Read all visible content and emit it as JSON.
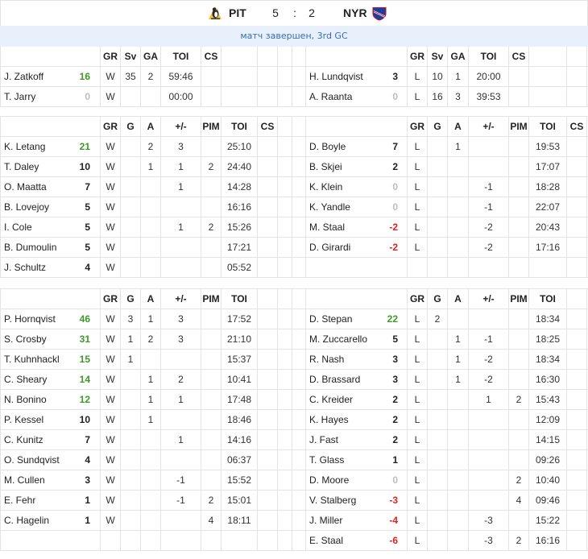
{
  "colors": {
    "points_high": "#3c9a28",
    "points_normal": "#222222",
    "points_zero": "#bdbdbd",
    "points_negative": "#e0221b",
    "status_text": "#3b6bb5",
    "status_bg": "#e8f1fb"
  },
  "header": {
    "home": {
      "abbr": "PIT",
      "score": "5",
      "logo_icon": "penguins-logo-icon"
    },
    "score_separator": ":",
    "away": {
      "abbr": "NYR",
      "score": "2",
      "logo_icon": "rangers-logo-icon"
    },
    "status": "матч завершен, 3rd GC"
  },
  "sections": [
    {
      "columns": [
        "GR",
        "Sv",
        "GA",
        "TOI",
        "CS"
      ],
      "home": [
        {
          "name": "J. Zatkoff",
          "points": 16,
          "stats": [
            "W",
            "35",
            "2",
            "59:46",
            ""
          ]
        },
        {
          "name": "T. Jarry",
          "points": 0,
          "stats": [
            "W",
            "",
            "",
            "00:00",
            ""
          ]
        }
      ],
      "away": [
        {
          "name": "H. Lundqvist",
          "points": 3,
          "stats": [
            "L",
            "10",
            "1",
            "20:00",
            ""
          ]
        },
        {
          "name": "A. Raanta",
          "points": 0,
          "stats": [
            "L",
            "16",
            "3",
            "39:53",
            ""
          ]
        }
      ]
    },
    {
      "columns": [
        "GR",
        "G",
        "A",
        "+/-",
        "PIM",
        "TOI",
        "CS"
      ],
      "home": [
        {
          "name": "K. Letang",
          "points": 21,
          "stats": [
            "W",
            "",
            "2",
            "3",
            "",
            "25:10",
            ""
          ]
        },
        {
          "name": "T. Daley",
          "points": 10,
          "stats": [
            "W",
            "",
            "1",
            "1",
            "2",
            "24:40",
            ""
          ]
        },
        {
          "name": "O. Maatta",
          "points": 7,
          "stats": [
            "W",
            "",
            "",
            "1",
            "",
            "14:28",
            ""
          ]
        },
        {
          "name": "B. Lovejoy",
          "points": 5,
          "stats": [
            "W",
            "",
            "",
            "",
            "",
            "16:16",
            ""
          ]
        },
        {
          "name": "I. Cole",
          "points": 5,
          "stats": [
            "W",
            "",
            "",
            "1",
            "2",
            "15:26",
            ""
          ]
        },
        {
          "name": "B. Dumoulin",
          "points": 5,
          "stats": [
            "W",
            "",
            "",
            "",
            "",
            "17:21",
            ""
          ]
        },
        {
          "name": "J. Schultz",
          "points": 4,
          "stats": [
            "W",
            "",
            "",
            "",
            "",
            "05:52",
            ""
          ]
        }
      ],
      "away": [
        {
          "name": "D. Boyle",
          "points": 7,
          "stats": [
            "L",
            "",
            "1",
            "",
            "",
            "19:53",
            ""
          ]
        },
        {
          "name": "B. Skjei",
          "points": 2,
          "stats": [
            "L",
            "",
            "",
            "",
            "",
            "17:07",
            ""
          ]
        },
        {
          "name": "K. Klein",
          "points": 0,
          "stats": [
            "L",
            "",
            "",
            "-1",
            "",
            "18:28",
            ""
          ]
        },
        {
          "name": "K. Yandle",
          "points": 0,
          "stats": [
            "L",
            "",
            "",
            "-1",
            "",
            "22:07",
            ""
          ]
        },
        {
          "name": "M. Staal",
          "points": -2,
          "stats": [
            "L",
            "",
            "",
            "-2",
            "",
            "20:43",
            ""
          ]
        },
        {
          "name": "D. Girardi",
          "points": -2,
          "stats": [
            "L",
            "",
            "",
            "-2",
            "",
            "17:16",
            ""
          ]
        }
      ]
    },
    {
      "columns": [
        "GR",
        "G",
        "A",
        "+/-",
        "PIM",
        "TOI"
      ],
      "home": [
        {
          "name": "P. Hornqvist",
          "points": 46,
          "stats": [
            "W",
            "3",
            "1",
            "3",
            "",
            "17:52"
          ]
        },
        {
          "name": "S. Crosby",
          "points": 31,
          "stats": [
            "W",
            "1",
            "2",
            "3",
            "",
            "21:10"
          ]
        },
        {
          "name": "T. Kuhnhackl",
          "points": 15,
          "stats": [
            "W",
            "1",
            "",
            "",
            "",
            "15:37"
          ]
        },
        {
          "name": "C. Sheary",
          "points": 14,
          "stats": [
            "W",
            "",
            "1",
            "2",
            "",
            "10:41"
          ]
        },
        {
          "name": "N. Bonino",
          "points": 12,
          "stats": [
            "W",
            "",
            "1",
            "1",
            "",
            "17:48"
          ]
        },
        {
          "name": "P. Kessel",
          "points": 10,
          "stats": [
            "W",
            "",
            "1",
            "",
            "",
            "18:46"
          ]
        },
        {
          "name": "C. Kunitz",
          "points": 7,
          "stats": [
            "W",
            "",
            "",
            "1",
            "",
            "14:16"
          ]
        },
        {
          "name": "O. Sundqvist",
          "points": 4,
          "stats": [
            "W",
            "",
            "",
            "",
            "",
            "06:37"
          ]
        },
        {
          "name": "M. Cullen",
          "points": 3,
          "stats": [
            "W",
            "",
            "",
            "-1",
            "",
            "15:52"
          ]
        },
        {
          "name": "E. Fehr",
          "points": 1,
          "stats": [
            "W",
            "",
            "",
            "-1",
            "2",
            "15:01"
          ]
        },
        {
          "name": "C. Hagelin",
          "points": 1,
          "stats": [
            "W",
            "",
            "",
            "",
            "4",
            "18:11"
          ]
        }
      ],
      "away": [
        {
          "name": "D. Stepan",
          "points": 22,
          "stats": [
            "L",
            "2",
            "",
            "",
            "",
            "18:34"
          ]
        },
        {
          "name": "M. Zuccarello",
          "points": 5,
          "stats": [
            "L",
            "",
            "1",
            "-1",
            "",
            "18:25"
          ]
        },
        {
          "name": "R. Nash",
          "points": 3,
          "stats": [
            "L",
            "",
            "1",
            "-2",
            "",
            "18:34"
          ]
        },
        {
          "name": "D. Brassard",
          "points": 3,
          "stats": [
            "L",
            "",
            "1",
            "-2",
            "",
            "16:30"
          ]
        },
        {
          "name": "C. Kreider",
          "points": 2,
          "stats": [
            "L",
            "",
            "",
            "1",
            "2",
            "15:43"
          ]
        },
        {
          "name": "K. Hayes",
          "points": 2,
          "stats": [
            "L",
            "",
            "",
            "",
            "",
            "12:09"
          ]
        },
        {
          "name": "J. Fast",
          "points": 2,
          "stats": [
            "L",
            "",
            "",
            "",
            "",
            "14:15"
          ]
        },
        {
          "name": "T. Glass",
          "points": 1,
          "stats": [
            "L",
            "",
            "",
            "",
            "",
            "09:26"
          ]
        },
        {
          "name": "D. Moore",
          "points": 0,
          "stats": [
            "L",
            "",
            "",
            "",
            "2",
            "10:40"
          ]
        },
        {
          "name": "V. Stalberg",
          "points": -3,
          "stats": [
            "L",
            "",
            "",
            "",
            "4",
            "09:46"
          ]
        },
        {
          "name": "J. Miller",
          "points": -4,
          "stats": [
            "L",
            "",
            "",
            "-3",
            "",
            "15:22"
          ]
        },
        {
          "name": "E. Staal",
          "points": -6,
          "stats": [
            "L",
            "",
            "",
            "-3",
            "2",
            "16:16"
          ]
        }
      ]
    }
  ]
}
